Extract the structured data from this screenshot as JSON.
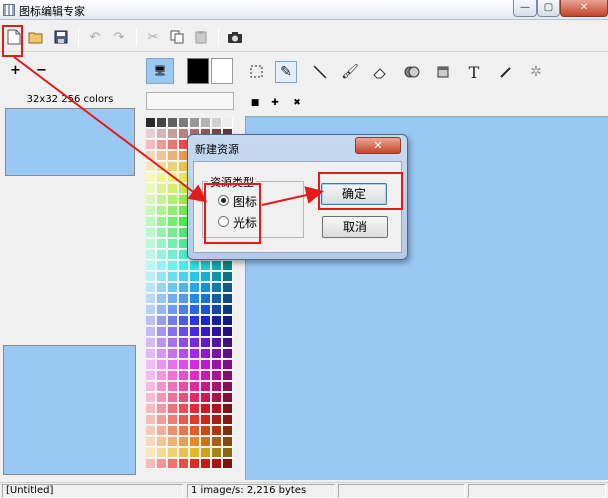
{
  "window": {
    "title": "图标编辑专家",
    "min_glyph": "—",
    "max_glyph": "▢",
    "close_glyph": "✕"
  },
  "left_panel": {
    "size_label": "32x32 256 colors",
    "plus_glyph": "+",
    "minus_glyph": "−"
  },
  "dialog": {
    "title": "新建资源",
    "close_glyph": "✕",
    "group_label": "资源类型",
    "radio_icon_label": "图标",
    "radio_cursor_label": "光标",
    "ok_label": "确定",
    "cancel_label": "取消",
    "selected": "图标"
  },
  "status": {
    "file": "[Untitled]",
    "info": "1 image/s: 2,216 bytes",
    "extra1": "",
    "extra2": ""
  },
  "toolbar_icons": [
    "new-file-icon",
    "open-folder-icon",
    "save-icon",
    "undo-icon",
    "redo-icon",
    "cut-icon",
    "copy-icon",
    "paste-icon",
    "capture-icon"
  ],
  "draw_icons": [
    "select-rect-icon",
    "pencil-icon",
    "line-icon",
    "brush-icon",
    "eraser-icon",
    "fill-icon",
    "bucket-icon",
    "text-icon",
    "eyedropper-icon",
    "magic-wand-icon"
  ],
  "colors": {
    "canvas": "#99c8f5",
    "annotation": "#e41b1b",
    "foreground": "#000000",
    "background": "#ffffff"
  }
}
